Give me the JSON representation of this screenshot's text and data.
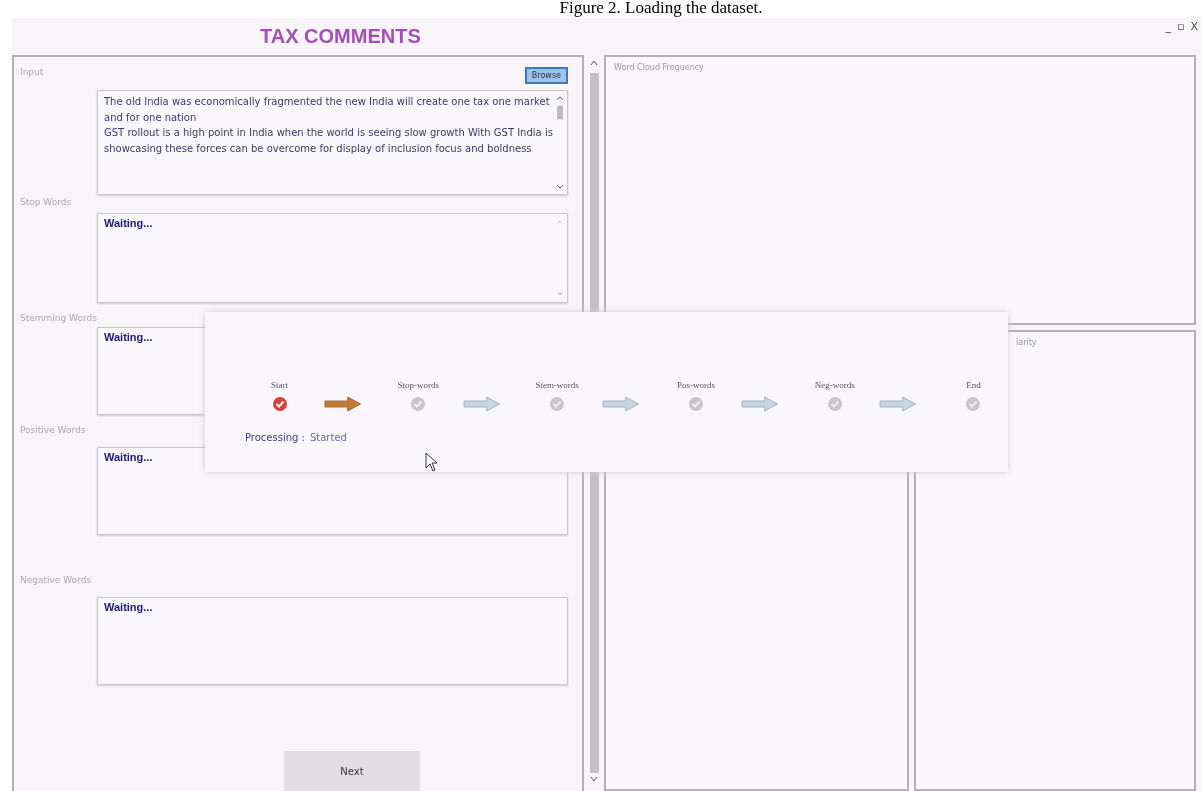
{
  "caption": "Figure 2. Loading the dataset.",
  "window": {
    "title": "TAX COMMENTS",
    "controls": [
      "_",
      "▫",
      "X"
    ]
  },
  "input": {
    "label": "Input",
    "browse": "Browse",
    "text": [
      "The old India was economically fragmented the new India will create one tax one market and for one nation",
      "GST rollout is a high point in India when the world is seeing slow growth With GST India is showcasing these forces can be overcome for display of inclusion focus and boldness"
    ]
  },
  "sections": [
    {
      "label": "Stop Words",
      "value": "Waiting...",
      "scrollbar": true
    },
    {
      "label": "Stemming Words",
      "value": "Waiting..."
    },
    {
      "label": "Positive Words",
      "value": "Waiting..."
    },
    {
      "label": "Negative Words",
      "value": "Waiting..."
    }
  ],
  "next_button": "Next",
  "word_cloud": {
    "title": "Word Cloud Frequency"
  },
  "polarity": {
    "title": "larity"
  },
  "progress": {
    "steps": [
      {
        "label": "Start",
        "done": true
      },
      {
        "label": "Stop-words",
        "done": false
      },
      {
        "label": "Stem-words",
        "done": false
      },
      {
        "label": "Pos-words",
        "done": false
      },
      {
        "label": "Neg-words",
        "done": false
      },
      {
        "label": "End",
        "done": false
      }
    ],
    "arrows": [
      {
        "active": true
      },
      {
        "active": false
      },
      {
        "active": false
      },
      {
        "active": false
      },
      {
        "active": false
      }
    ],
    "status_label": "Processing :",
    "status_value": "Started"
  }
}
